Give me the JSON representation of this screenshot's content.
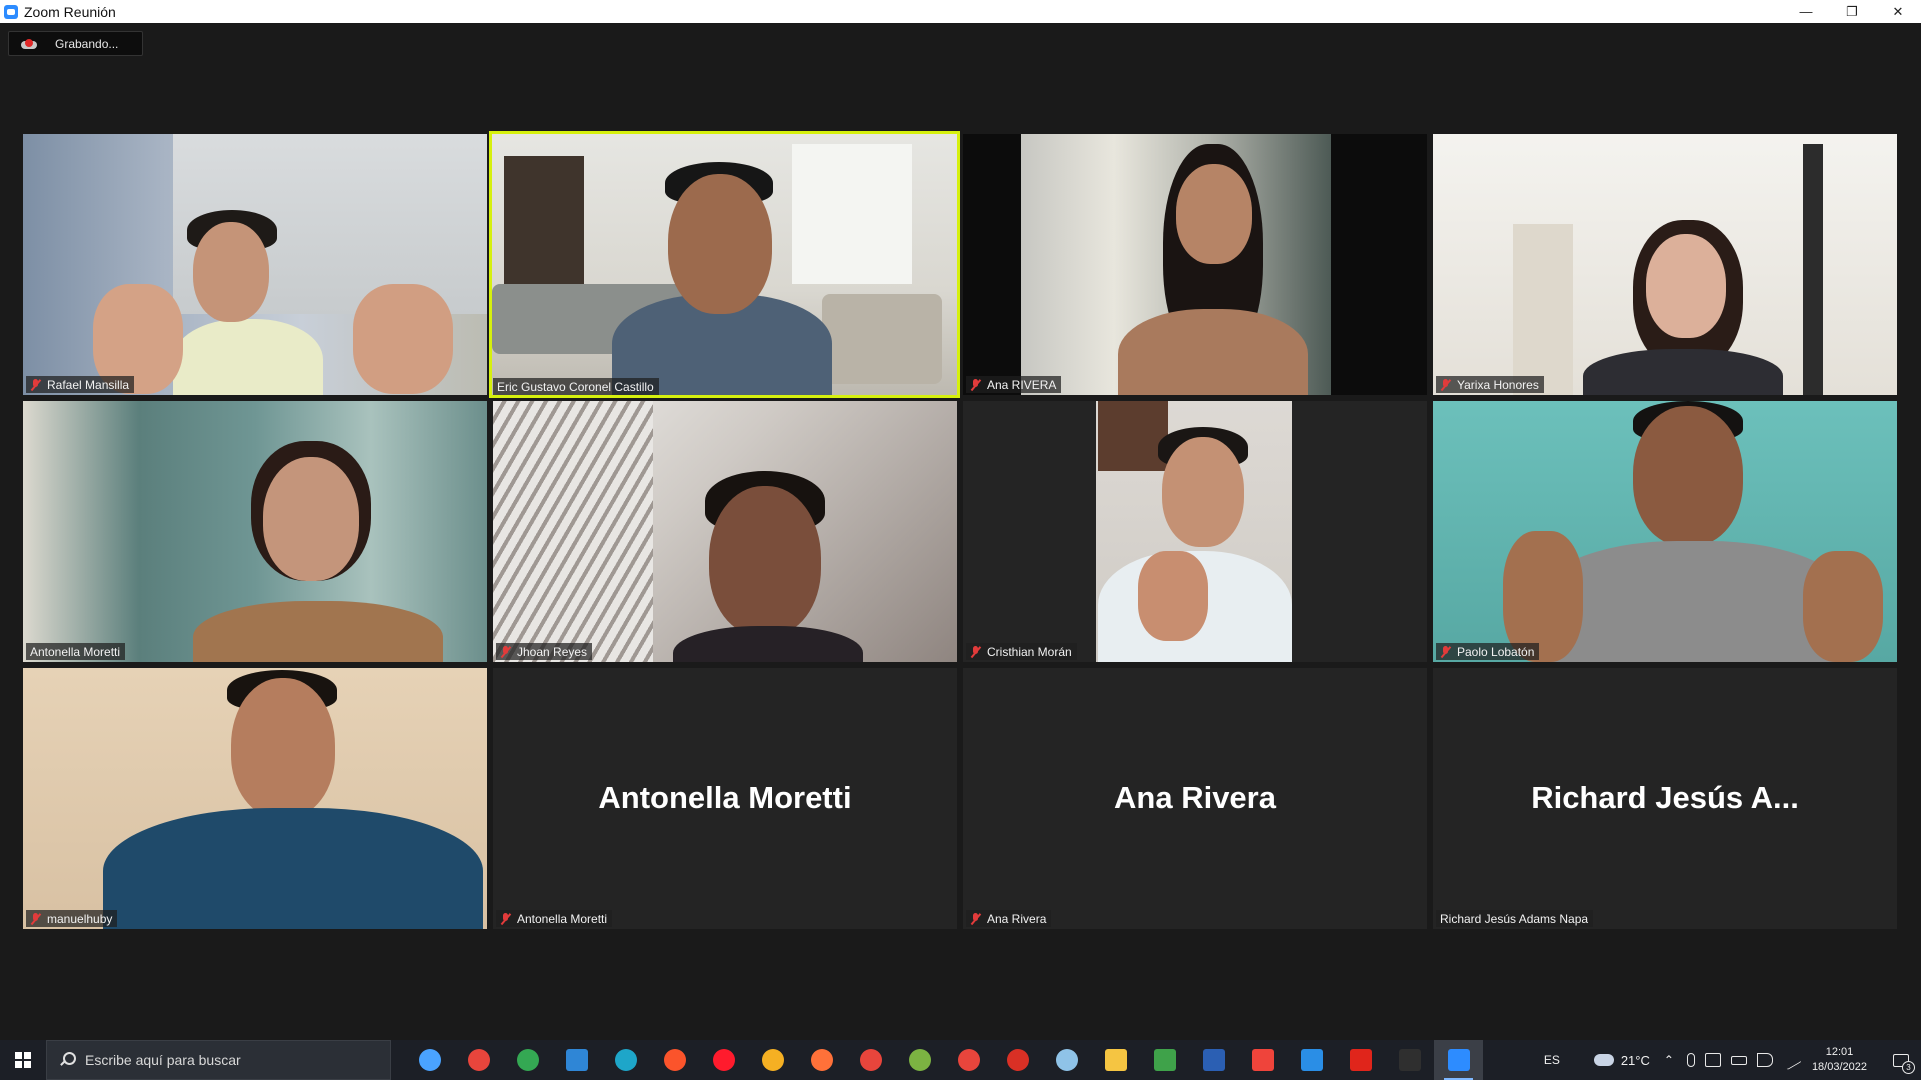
{
  "window": {
    "title": "Zoom Reunión",
    "minimize_glyph": "—",
    "restore_glyph": "❐",
    "close_glyph": "✕"
  },
  "recording": {
    "label": "Grabando..."
  },
  "colors": {
    "active_speaker_border": "#d6f00e",
    "muted_mic": "#e23b3b",
    "tile_background": "#242424",
    "meeting_background": "#1a1a1a",
    "zoom_blue": "#2d8cff"
  },
  "participants": [
    {
      "name": "Rafael Mansilla",
      "muted": true,
      "video_on": true,
      "icon": "muted-mic-icon"
    },
    {
      "name": "Eric Gustavo Coronel Castillo",
      "muted": false,
      "video_on": true,
      "active_speaker": true
    },
    {
      "name": "Ana RIVERA",
      "muted": true,
      "video_on": true,
      "icon": "muted-mic-icon"
    },
    {
      "name": "Yarixa Honores",
      "muted": true,
      "video_on": true,
      "icon": "muted-mic-icon"
    },
    {
      "name": "Antonella Moretti",
      "muted": false,
      "video_on": true
    },
    {
      "name": "Jhoan Reyes",
      "muted": true,
      "video_on": true,
      "icon": "muted-mic-icon"
    },
    {
      "name": "Cristhian Morán",
      "muted": true,
      "video_on": true,
      "icon": "muted-mic-icon"
    },
    {
      "name": "Paolo Lobatón",
      "muted": true,
      "video_on": true,
      "icon": "muted-mic-icon"
    },
    {
      "name": "manuelhuby",
      "muted": true,
      "video_on": true,
      "icon": "muted-mic-icon"
    },
    {
      "name": "Antonella Moretti",
      "display_name": "Antonella Moretti",
      "muted": true,
      "video_on": false,
      "icon": "muted-mic-icon"
    },
    {
      "name": "Ana Rivera",
      "display_name": "Ana Rivera",
      "muted": true,
      "video_on": false,
      "icon": "muted-mic-icon"
    },
    {
      "name": "Richard Jesús Adams Napa",
      "display_name": "Richard  Jesús  A...",
      "muted": false,
      "video_on": false
    }
  ],
  "taskbar": {
    "search_placeholder": "Escribe aquí para buscar",
    "apps": [
      {
        "icon": "cortana-icon",
        "color": "#4aa3ff"
      },
      {
        "icon": "chrome-icon",
        "color": "#e8453c"
      },
      {
        "icon": "chrome-icon",
        "color": "#34a853"
      },
      {
        "icon": "mail-icon",
        "color": "#2f86d6"
      },
      {
        "icon": "edge-icon",
        "color": "#1ea6c9"
      },
      {
        "icon": "brave-icon",
        "color": "#fb542b"
      },
      {
        "icon": "opera-icon",
        "color": "#ff1b2d"
      },
      {
        "icon": "tor-icon",
        "color": "#f5b023"
      },
      {
        "icon": "firefox-icon",
        "color": "#ff7139"
      },
      {
        "icon": "chrome-icon",
        "color": "#e8453c"
      },
      {
        "icon": "chrome-icon",
        "color": "#7cb342"
      },
      {
        "icon": "chrome-icon",
        "color": "#e8453c"
      },
      {
        "icon": "chrome-icon",
        "color": "#d93025"
      },
      {
        "icon": "paint-icon",
        "color": "#8fc3e8"
      },
      {
        "icon": "folder-icon",
        "color": "#f5c542"
      },
      {
        "icon": "notepad-icon",
        "color": "#3fa24a"
      },
      {
        "icon": "word-icon",
        "color": "#2b5fb3"
      },
      {
        "icon": "anydesk-icon",
        "color": "#ef443b"
      },
      {
        "icon": "vscode-icon",
        "color": "#2a8ee6"
      },
      {
        "icon": "acrobat-icon",
        "color": "#e0251b"
      },
      {
        "icon": "terminal-icon",
        "color": "#2f2f2f"
      },
      {
        "icon": "zoom-icon",
        "color": "#2d8cff",
        "active": true
      }
    ],
    "language": "ES",
    "temperature": "21°C",
    "time": "12:01",
    "date": "18/03/2022",
    "notification_count": "3"
  }
}
